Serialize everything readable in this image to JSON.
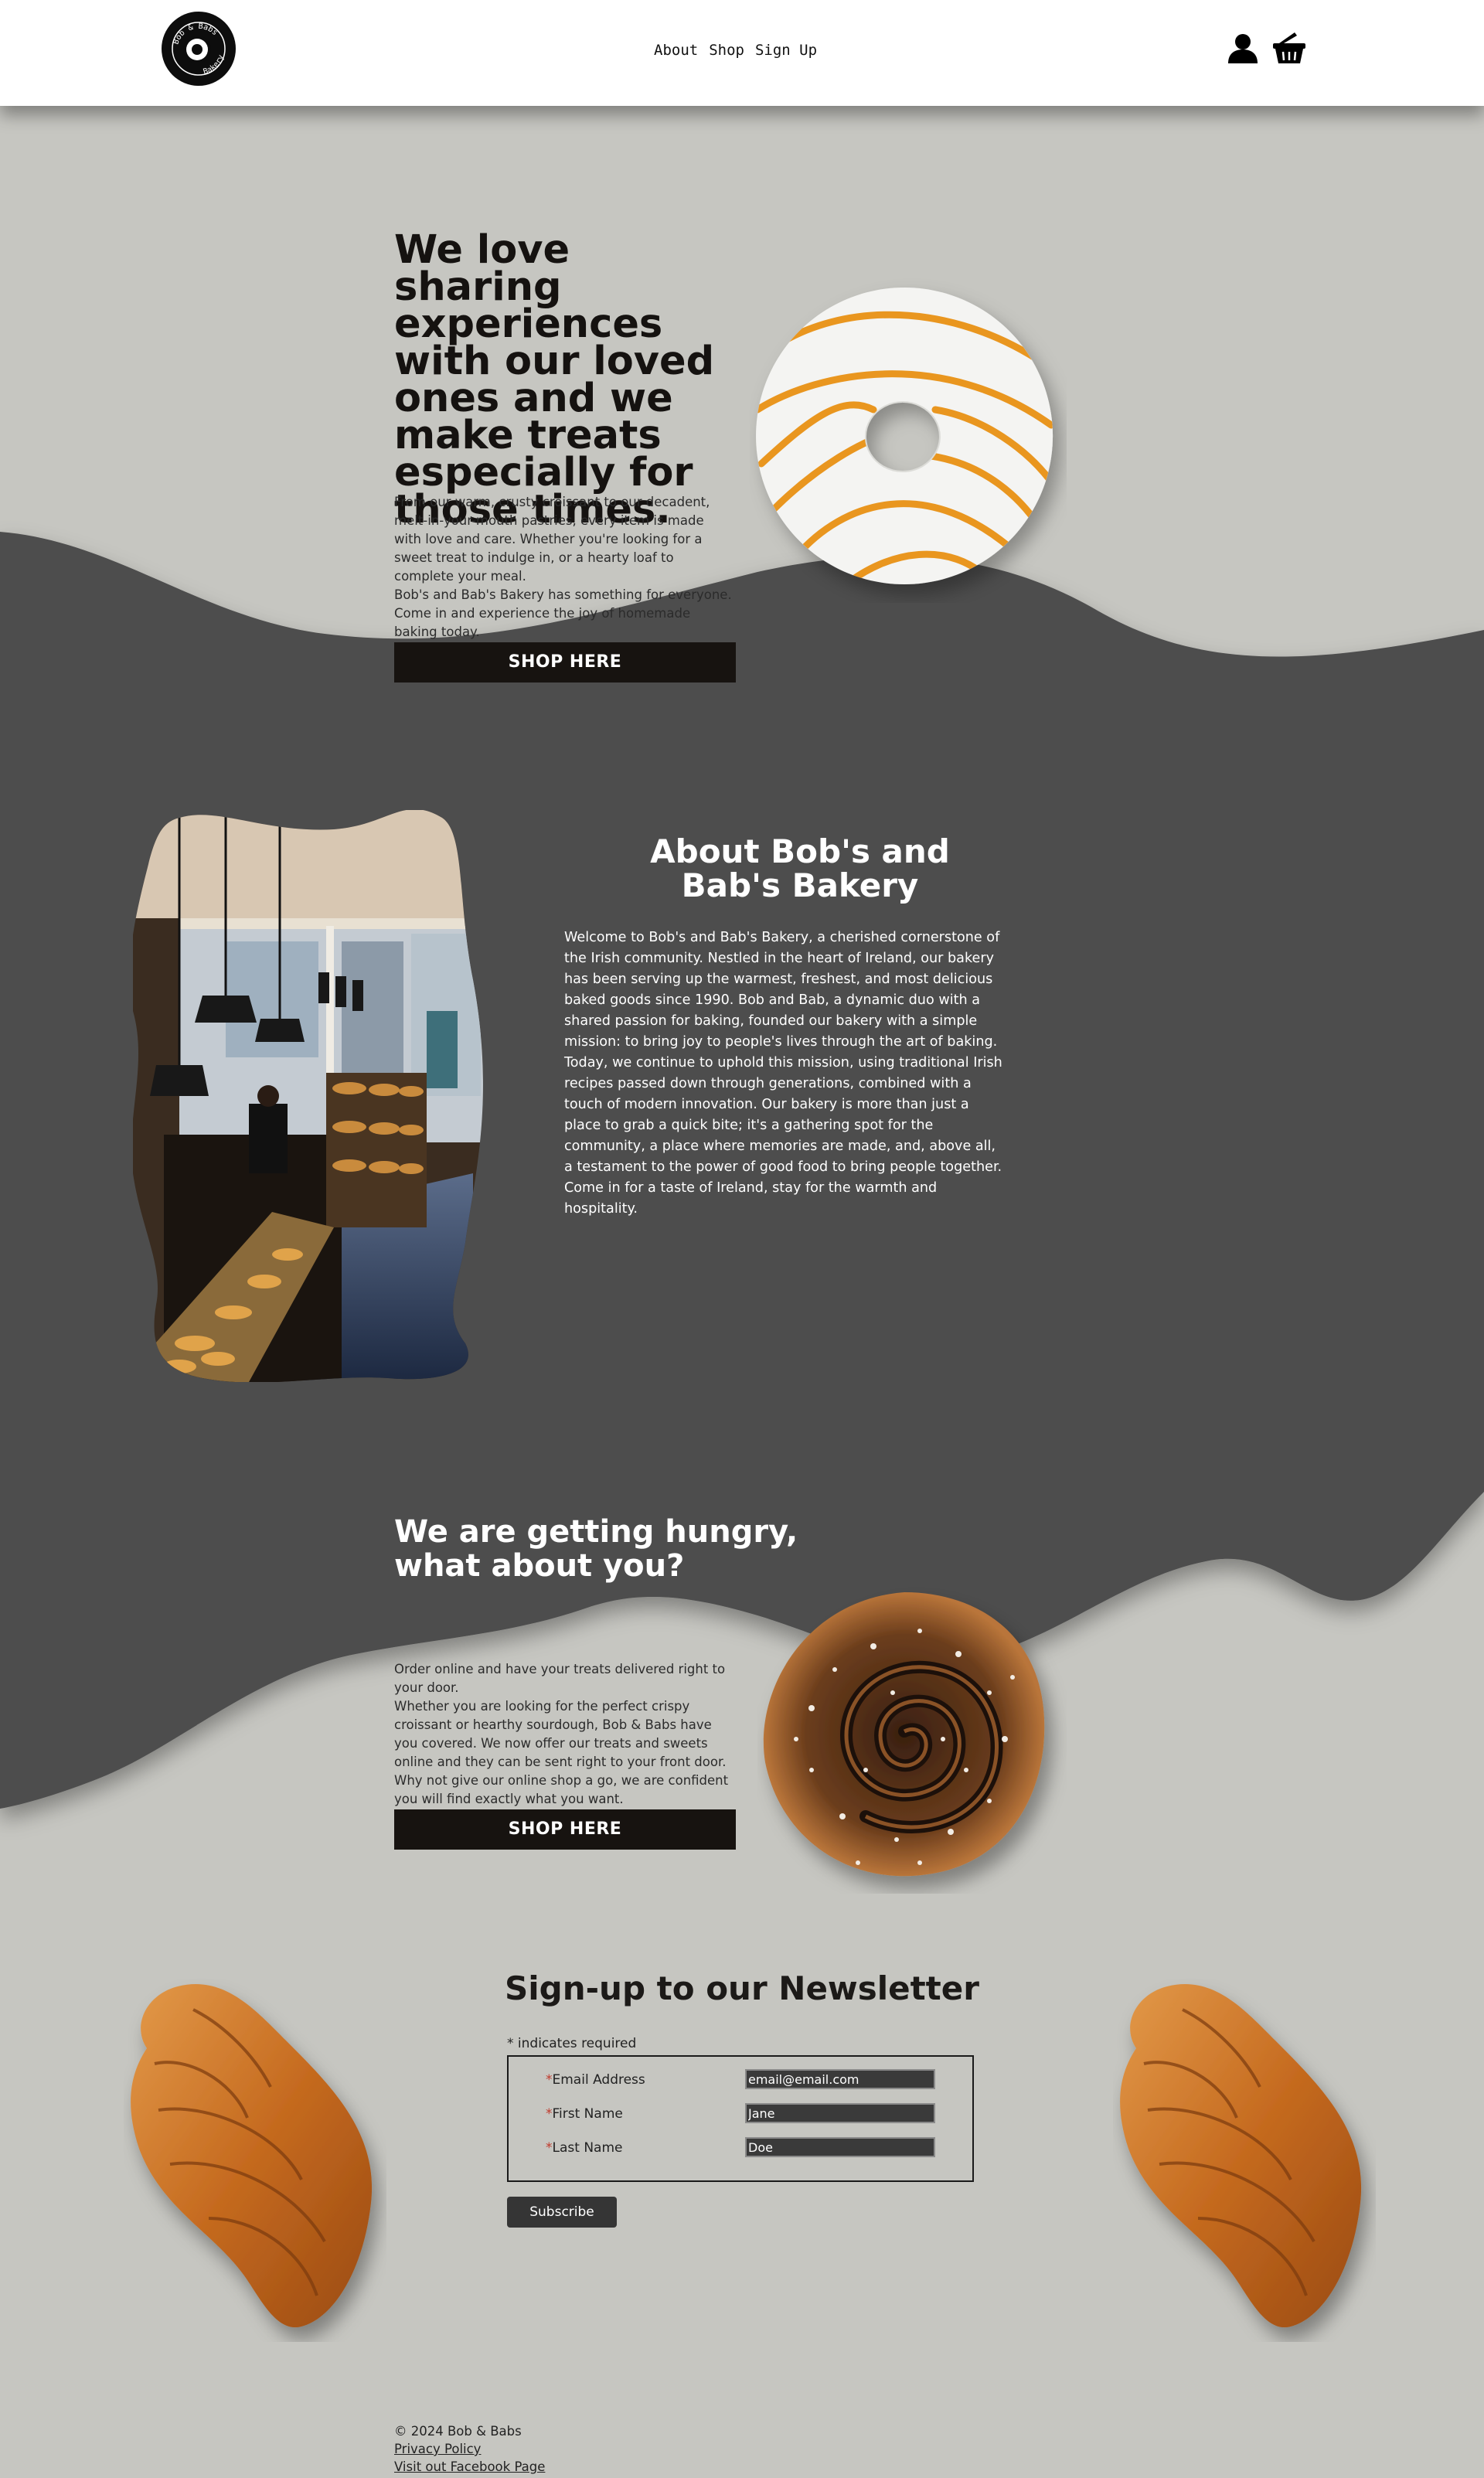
{
  "header": {
    "logo_text_top": "Bob & Babs",
    "logo_text_bottom": "Bakery",
    "nav": [
      "About",
      "Shop",
      "Sign Up"
    ]
  },
  "hero": {
    "title": "We love sharing experiences with our loved ones and we make treats especially for those times.",
    "paragraphs": [
      "From our warm, crusty croissant to our decadent, melt-in-your-mouth pastries, every item is made with love and care. Whether you're looking for a sweet treat to indulge in, or a hearty loaf to complete your meal.",
      "Bob's and Bab's Bakery has something for everyone. Come in and experience the joy of homemade baking today."
    ],
    "button": "SHOP HERE"
  },
  "about": {
    "title": "About Bob's and Bab's Bakery",
    "body": "Welcome to Bob's and Bab's Bakery, a cherished cornerstone of the Irish community. Nestled in the heart of Ireland, our bakery has been serving up the warmest, freshest, and most delicious baked goods since 1990. Bob and Bab, a dynamic duo with a shared passion for baking, founded our bakery with a simple mission: to bring joy to people's lives through the art of baking. Today, we continue to uphold this mission, using traditional Irish recipes passed down through generations, combined with a touch of modern innovation. Our bakery is more than just a place to grab a quick bite; it's a gathering spot for the community, a place where memories are made, and, above all, a testament to the power of good food to bring people together. Come in for a taste of Ireland, stay for the warmth and hospitality."
  },
  "hungry": {
    "title": "We are getting hungry, what about you?",
    "paragraphs": [
      "Order online and have your treats delivered right to your door.",
      "Whether you are looking for the perfect crispy croissant or hearthy sourdough, Bob & Babs have you covered. We now offer our treats and sweets online and they can be sent right to your front door. Why not give our online shop a go, we are confident you will find exactly what you want."
    ],
    "button": "SHOP HERE"
  },
  "newsletter": {
    "title": "Sign-up to our Newsletter",
    "required_note": "* indicates required",
    "fields": [
      {
        "label": "Email Address",
        "value": "email@email.com"
      },
      {
        "label": "First Name",
        "value": "Jane"
      },
      {
        "label": "Last Name",
        "value": "Doe"
      }
    ],
    "submit": "Subscribe"
  },
  "footer": {
    "copyright": "© 2024 Bob & Babs",
    "links": [
      "Privacy Policy",
      "Visit out Facebook Page"
    ]
  },
  "colors": {
    "page_bg": "#c6c6c1",
    "wave_dark": "#4d4d4d",
    "button_dark": "#171310",
    "required_star": "#c0392b"
  },
  "icons": [
    "user-icon",
    "basket-icon"
  ]
}
